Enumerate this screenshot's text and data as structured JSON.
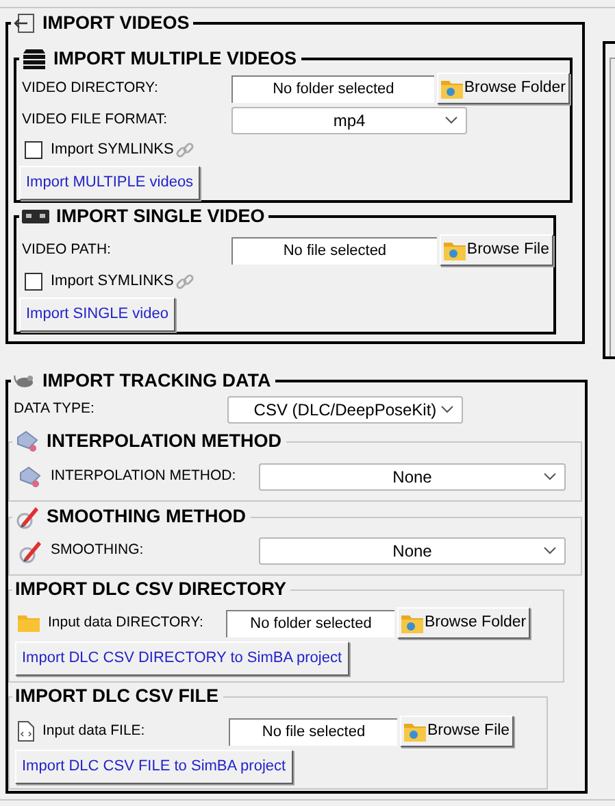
{
  "sections": [
    {
      "title": "IMPORT VIDEOS",
      "groups": [
        {
          "title": "IMPORT MULTIPLE VIDEOS",
          "rows": [
            {
              "kind": "path",
              "label": "VIDEO DIRECTORY:",
              "value": "No folder selected",
              "button": "Browse Folder"
            },
            {
              "kind": "combo",
              "label": "VIDEO FILE FORMAT:",
              "value": "mp4"
            },
            {
              "kind": "check",
              "label": "Import SYMLINKS",
              "checked": false
            },
            {
              "kind": "action",
              "label": "Import MULTIPLE videos"
            }
          ]
        },
        {
          "title": "IMPORT SINGLE VIDEO",
          "rows": [
            {
              "kind": "path",
              "label": "VIDEO PATH:",
              "value": "No file selected",
              "button": "Browse File"
            },
            {
              "kind": "check",
              "label": "Import SYMLINKS",
              "checked": false
            },
            {
              "kind": "action",
              "label": "Import SINGLE video"
            }
          ]
        }
      ]
    },
    {
      "title": "IMPORT TRACKING DATA",
      "rows": [
        {
          "kind": "combo",
          "label": "DATA TYPE:",
          "value": "CSV (DLC/DeepPoseKit)"
        }
      ],
      "groups": [
        {
          "title": "INTERPOLATION METHOD",
          "rows": [
            {
              "kind": "combo",
              "label": "INTERPOLATION METHOD:",
              "value": "None"
            }
          ]
        },
        {
          "title": "SMOOTHING METHOD",
          "rows": [
            {
              "kind": "combo",
              "label": "SMOOTHING:",
              "value": "None"
            }
          ]
        },
        {
          "title": "IMPORT DLC CSV DIRECTORY",
          "rows": [
            {
              "kind": "path",
              "label": "Input data DIRECTORY:",
              "value": "No folder selected",
              "button": "Browse Folder"
            },
            {
              "kind": "action",
              "label": "Import DLC CSV DIRECTORY to SimBA project"
            }
          ]
        },
        {
          "title": "IMPORT DLC CSV FILE",
          "rows": [
            {
              "kind": "path",
              "label": "Input data FILE:",
              "value": "No file selected",
              "button": "Browse File"
            },
            {
              "kind": "action",
              "label": "Import DLC CSV FILE to SimBA project"
            }
          ]
        }
      ]
    }
  ]
}
